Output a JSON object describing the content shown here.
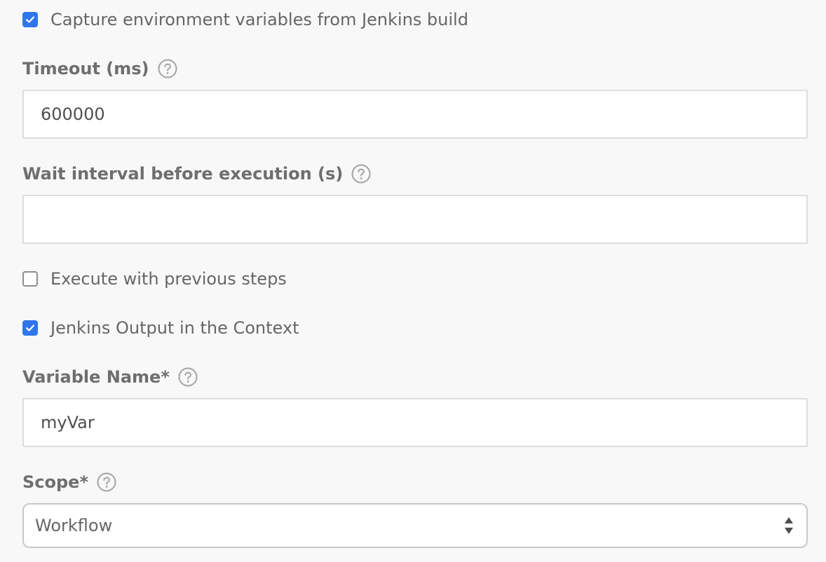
{
  "form": {
    "capture_env": {
      "label": "Capture environment variables from Jenkins build",
      "checked": true
    },
    "timeout": {
      "label": "Timeout (ms)",
      "value": "600000"
    },
    "wait_interval": {
      "label": "Wait interval before execution (s)",
      "value": ""
    },
    "execute_with_previous": {
      "label": "Execute with previous steps",
      "checked": false
    },
    "jenkins_output": {
      "label": "Jenkins Output in the Context",
      "checked": true
    },
    "variable_name": {
      "label": "Variable Name*",
      "value": "myVar"
    },
    "scope": {
      "label": "Scope*",
      "value": "Workflow"
    }
  },
  "icons": {
    "check": "check-icon",
    "help": "question-circle-icon",
    "select": "up-down-arrows-icon"
  },
  "colors": {
    "background": "#f8f8f8",
    "accent": "#2f76ec",
    "text": "#666666",
    "label": "#6e6e6e",
    "border": "#dddddd"
  }
}
